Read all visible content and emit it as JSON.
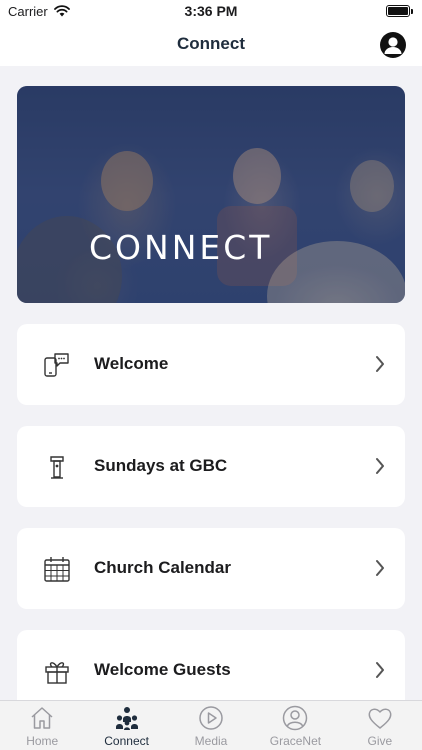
{
  "status_bar": {
    "carrier": "Carrier",
    "time": "3:36 PM"
  },
  "nav": {
    "title": "Connect"
  },
  "hero": {
    "text": "CONNECT"
  },
  "cards": [
    {
      "label": "Welcome",
      "icon": "phone-chat-icon"
    },
    {
      "label": "Sundays at GBC",
      "icon": "podium-icon"
    },
    {
      "label": "Church Calendar",
      "icon": "calendar-icon"
    },
    {
      "label": "Welcome Guests",
      "icon": "gift-icon"
    }
  ],
  "tabs": [
    {
      "label": "Home",
      "icon": "home-icon",
      "active": false
    },
    {
      "label": "Connect",
      "icon": "people-icon",
      "active": true
    },
    {
      "label": "Media",
      "icon": "play-icon",
      "active": false
    },
    {
      "label": "GraceNet",
      "icon": "person-circle-icon",
      "active": false
    },
    {
      "label": "Give",
      "icon": "heart-icon",
      "active": false
    }
  ],
  "colors": {
    "accent": "#1f2d3d",
    "inactive": "#9a9aa0",
    "background": "#f2f2f6"
  }
}
